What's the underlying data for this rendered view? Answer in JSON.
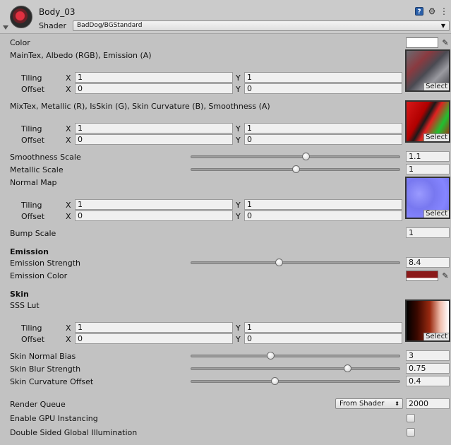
{
  "header": {
    "material_name": "Body_03",
    "shader_label": "Shader",
    "shader_value": "BadDog/BGStandard",
    "help_icon": "help-icon",
    "settings_icon": "settings-icon",
    "menu_icon": "menu-icon"
  },
  "color": {
    "label": "Color",
    "swatch_color": "#ffffff"
  },
  "maintex": {
    "label": "MainTex, Albedo (RGB), Emission (A)",
    "tiling_label": "Tiling",
    "offset_label": "Offset",
    "tiling_x": "1",
    "tiling_y": "1",
    "offset_x": "0",
    "offset_y": "0",
    "select_label": "Select"
  },
  "mixtex": {
    "label": "MixTex, Metallic (R), IsSkin (G), Skin Curvature (B), Smoothness (A)",
    "tiling_label": "Tiling",
    "offset_label": "Offset",
    "tiling_x": "1",
    "tiling_y": "1",
    "offset_x": "0",
    "offset_y": "0",
    "select_label": "Select"
  },
  "smoothness": {
    "label": "Smoothness Scale",
    "value": "1.1",
    "level": 0.55
  },
  "metallic": {
    "label": "Metallic Scale",
    "value": "1",
    "level": 0.5
  },
  "normalmap": {
    "label": "Normal Map",
    "tiling_label": "Tiling",
    "offset_label": "Offset",
    "tiling_x": "1",
    "tiling_y": "1",
    "offset_x": "0",
    "offset_y": "0",
    "select_label": "Select"
  },
  "bump": {
    "label": "Bump Scale",
    "value": "1"
  },
  "emission": {
    "section_title": "Emission",
    "strength_label": "Emission Strength",
    "strength_value": "8.4",
    "strength_level": 0.42,
    "color_label": "Emission Color",
    "color_swatch": "#8b1a1a"
  },
  "skin": {
    "section_title": "Skin",
    "sss_label": "SSS Lut",
    "tiling_label": "Tiling",
    "offset_label": "Offset",
    "tiling_x": "1",
    "tiling_y": "1",
    "offset_x": "0",
    "offset_y": "0",
    "select_label": "Select",
    "normal_bias_label": "Skin Normal Bias",
    "normal_bias_value": "3",
    "normal_bias_level": 0.38,
    "blur_label": "Skin Blur Strength",
    "blur_value": "0.75",
    "blur_level": 0.75,
    "curv_label": "Skin Curvature Offset",
    "curv_value": "0.4",
    "curv_level": 0.4
  },
  "render": {
    "queue_label": "Render Queue",
    "queue_mode": "From Shader",
    "queue_value": "2000",
    "gpu_label": "Enable GPU Instancing",
    "dsgi_label": "Double Sided Global Illumination"
  },
  "axes": {
    "x": "X",
    "y": "Y"
  }
}
